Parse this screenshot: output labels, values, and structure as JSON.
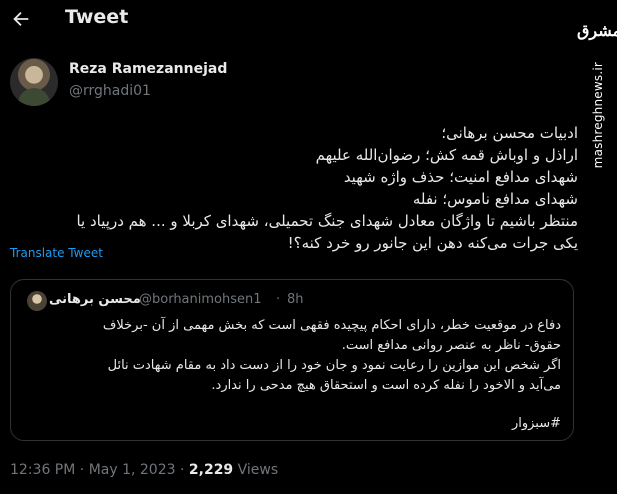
{
  "header": {
    "title": "Tweet"
  },
  "brand": {
    "logo_text": "مشرق",
    "site": "mashreghnews.ir"
  },
  "author": {
    "name": "Reza Ramezannejad",
    "handle": "@rrghadi01"
  },
  "tweet": {
    "text": "ادبیات محسن برهانی؛\nاراذل و اوباش قمه کش؛ رضوان‌الله علیهم\nشهدای مدافع امنیت؛ حذف واژه شهید\nشهدای مدافع ناموس؛ نفله\nمنتظر باشیم تا واژگان معادل شهدای جنگ تحمیلی، شهدای کربلا و ... هم درپیاد یا\nیکی جرات می‌کنه دهن این جانور رو خرد کنه؟!",
    "translate_label": "Translate Tweet",
    "time": "12:36 PM",
    "separator": "·",
    "date": "May 1, 2023",
    "views_count": "2,229",
    "views_label": "Views"
  },
  "quote": {
    "name": "محسن برهانی",
    "handle": "@borhanimohsen1",
    "separator": "·",
    "time": "8h",
    "text": "دفاع در موقعیت خطر، دارای احکام پیچیده فقهی است که بخش مهمی از آن -برخلاف\nحقوق- ناظر به عنصر روانی مدافع است.\nاگر شخص این موازین را رعایت نمود و جان خود را از دست داد به مقام شهادت نائل\nمی‌آید و الا‌خود را نفله کرده است و استحقاق هیچ مدحی را ندارد.",
    "hashtag": "#سبزوار"
  }
}
